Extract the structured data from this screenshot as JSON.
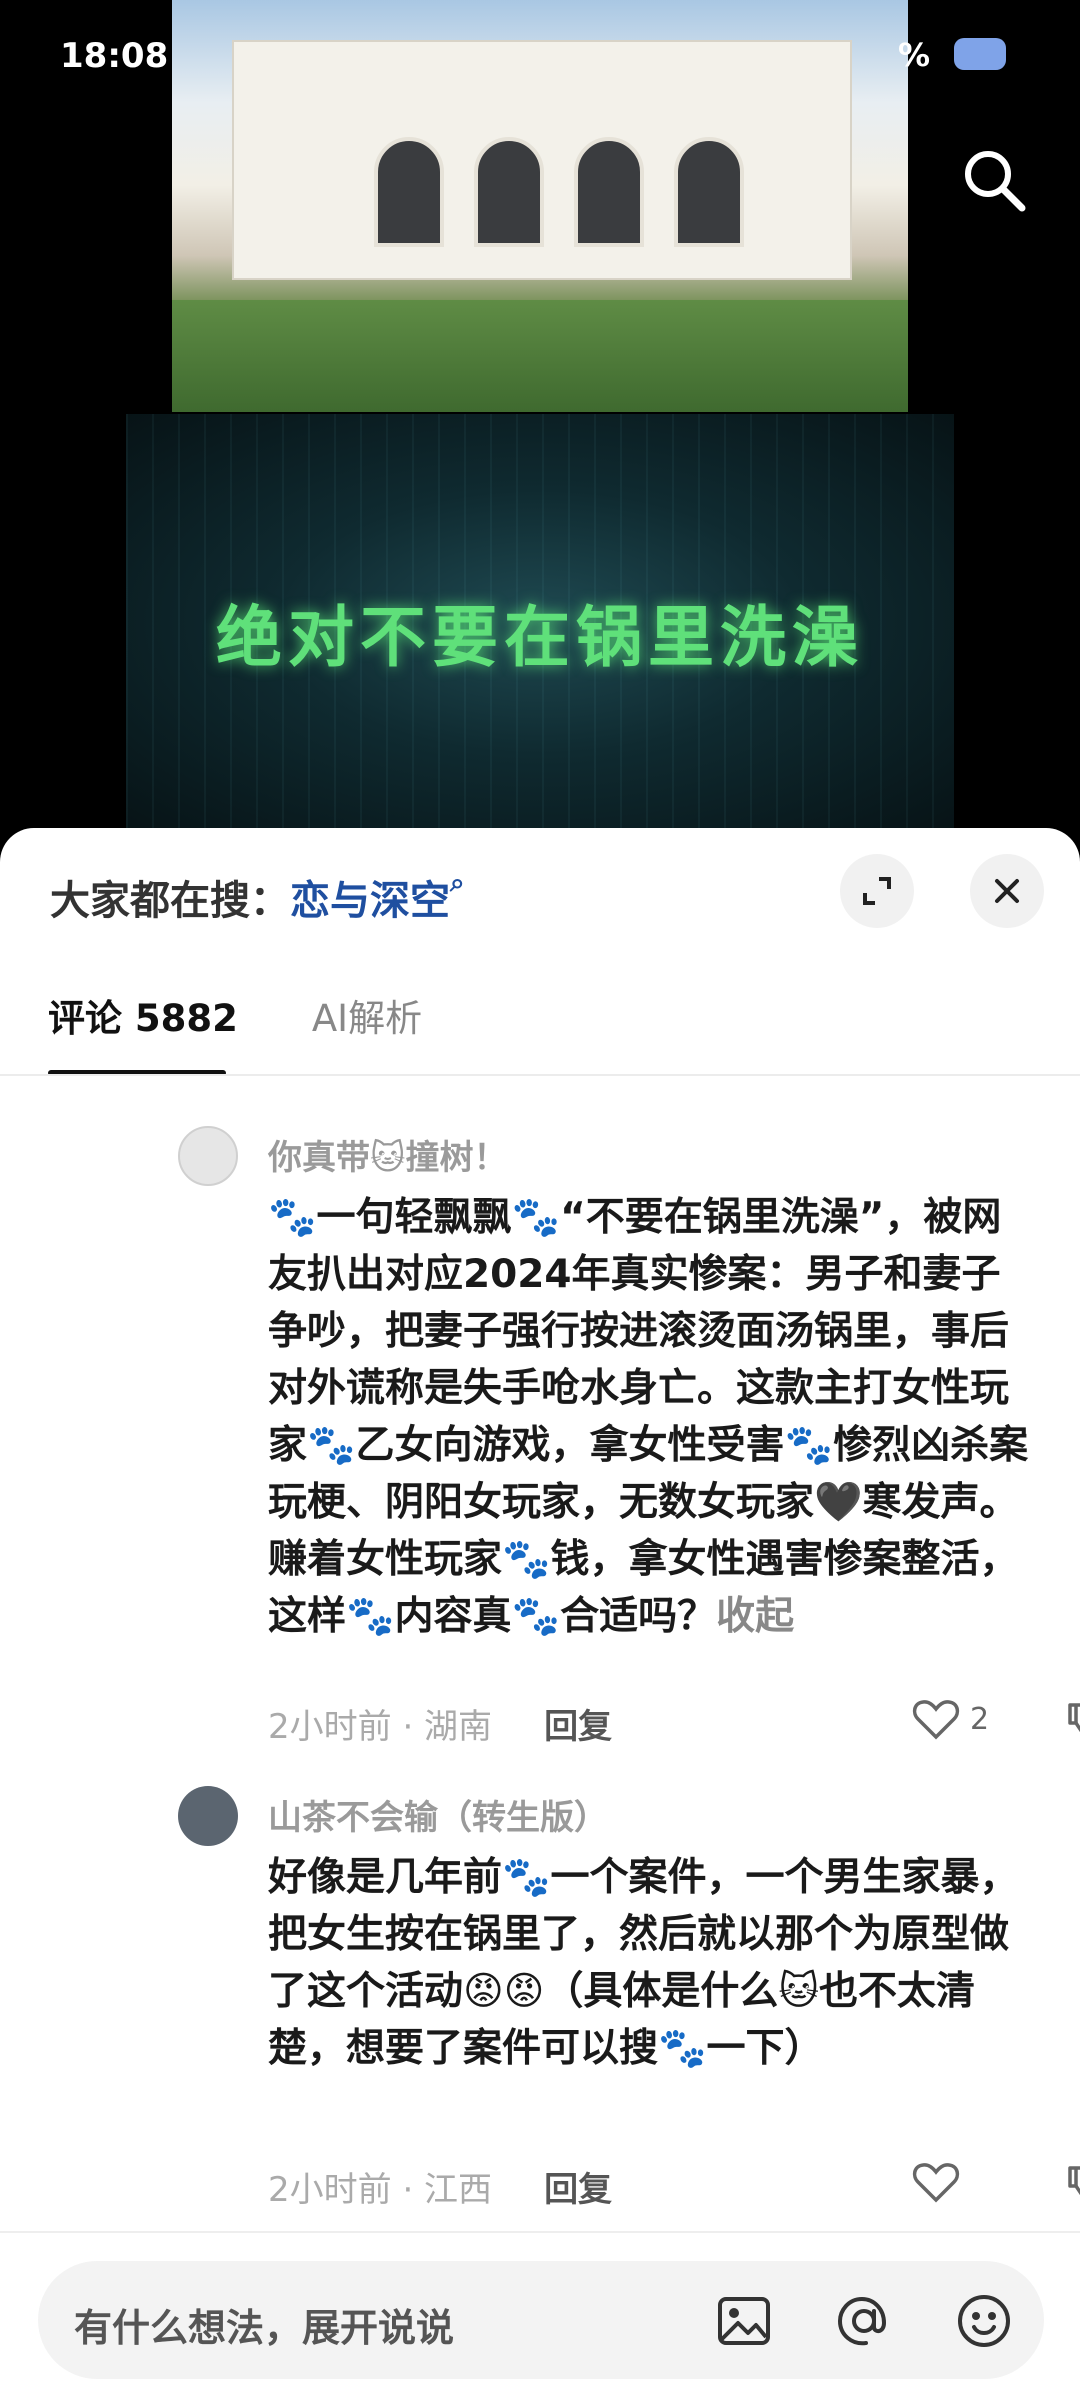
{
  "status": {
    "time": "18:08",
    "battery": "%"
  },
  "video": {
    "caption": "绝对不要在锅里洗澡"
  },
  "sheet": {
    "hot_search_prefix": "大家都在搜：",
    "hot_search_term": "恋与深空",
    "tabs": [
      {
        "label": "评论",
        "count": "5882"
      },
      {
        "label": "AI解析"
      }
    ]
  },
  "comments": [
    {
      "author": "你真带🐱撞树！",
      "text": "🐾一句轻飘飘🐾“不要在锅里洗澡”，被网友扒出对应2024年真实惨案：男子和妻子争吵，把妻子强行按进滚烫面汤锅里，事后对外谎称是失手呛水身亡。这款主打女性玩家🐾乙女向游戏，拿女性受害🐾惨烈凶杀案玩梗、阴阳女玩家，无数女玩家🖤寒发声。赚着女性玩家🐾钱，拿女性遇害惨案整活，这样🐾内容真🐾合适吗？",
      "collapse": "收起",
      "time_location": "2小时前 · 湖南",
      "reply": "回复",
      "likes": "2"
    },
    {
      "author": "山茶不会输（转生版）",
      "text": "好像是几年前🐾一个案件，一个男生家暴，把女生按在锅里了，然后就以那个为原型做了这个活动😡😡（具体是什么🐱也不太清楚，想要了案件可以搜🐾一下）",
      "time_location": "2小时前 · 江西",
      "reply": "回复",
      "likes": ""
    }
  ],
  "input": {
    "placeholder": "有什么想法，展开说说"
  },
  "colors": {
    "accent_link": "#1f4fa0",
    "caption_green": "#5fe07a"
  },
  "icons": [
    "search-icon",
    "expand-icon",
    "close-icon",
    "heart-icon",
    "thumbs-down-icon",
    "image-icon",
    "at-icon",
    "emoji-icon"
  ]
}
